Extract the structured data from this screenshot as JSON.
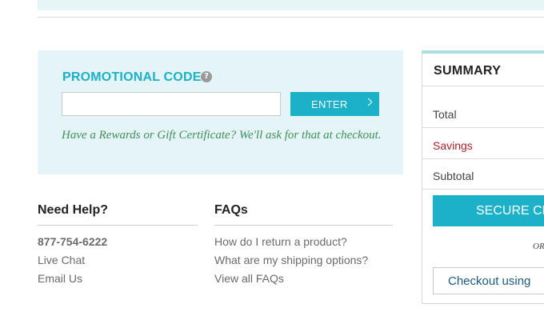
{
  "promo": {
    "title": "PROMOTIONAL CODE",
    "help_glyph": "?",
    "input_value": "",
    "input_placeholder": "",
    "enter_label": "ENTER",
    "note": "Have a Rewards or Gift Certificate? We'll ask for that at checkout."
  },
  "help": {
    "heading": "Need Help?",
    "phone": "877-754-6222",
    "live_chat": "Live Chat",
    "email": "Email Us"
  },
  "faqs": {
    "heading": "FAQs",
    "items": [
      "How do I return a product?",
      "What are my shipping options?",
      "View all FAQs"
    ]
  },
  "summary": {
    "title": "SUMMARY",
    "total_label": "Total",
    "savings_label": "Savings",
    "subtotal_label": "Subtotal",
    "secure_button": "SECURE CHECKOUT",
    "or_text": "OR",
    "checkout_using": "Checkout using"
  },
  "colors": {
    "accent": "#1ab1c9",
    "promo_background": "#e5f4f7",
    "savings": "#b0202c",
    "note_green": "#3f8f5a"
  }
}
